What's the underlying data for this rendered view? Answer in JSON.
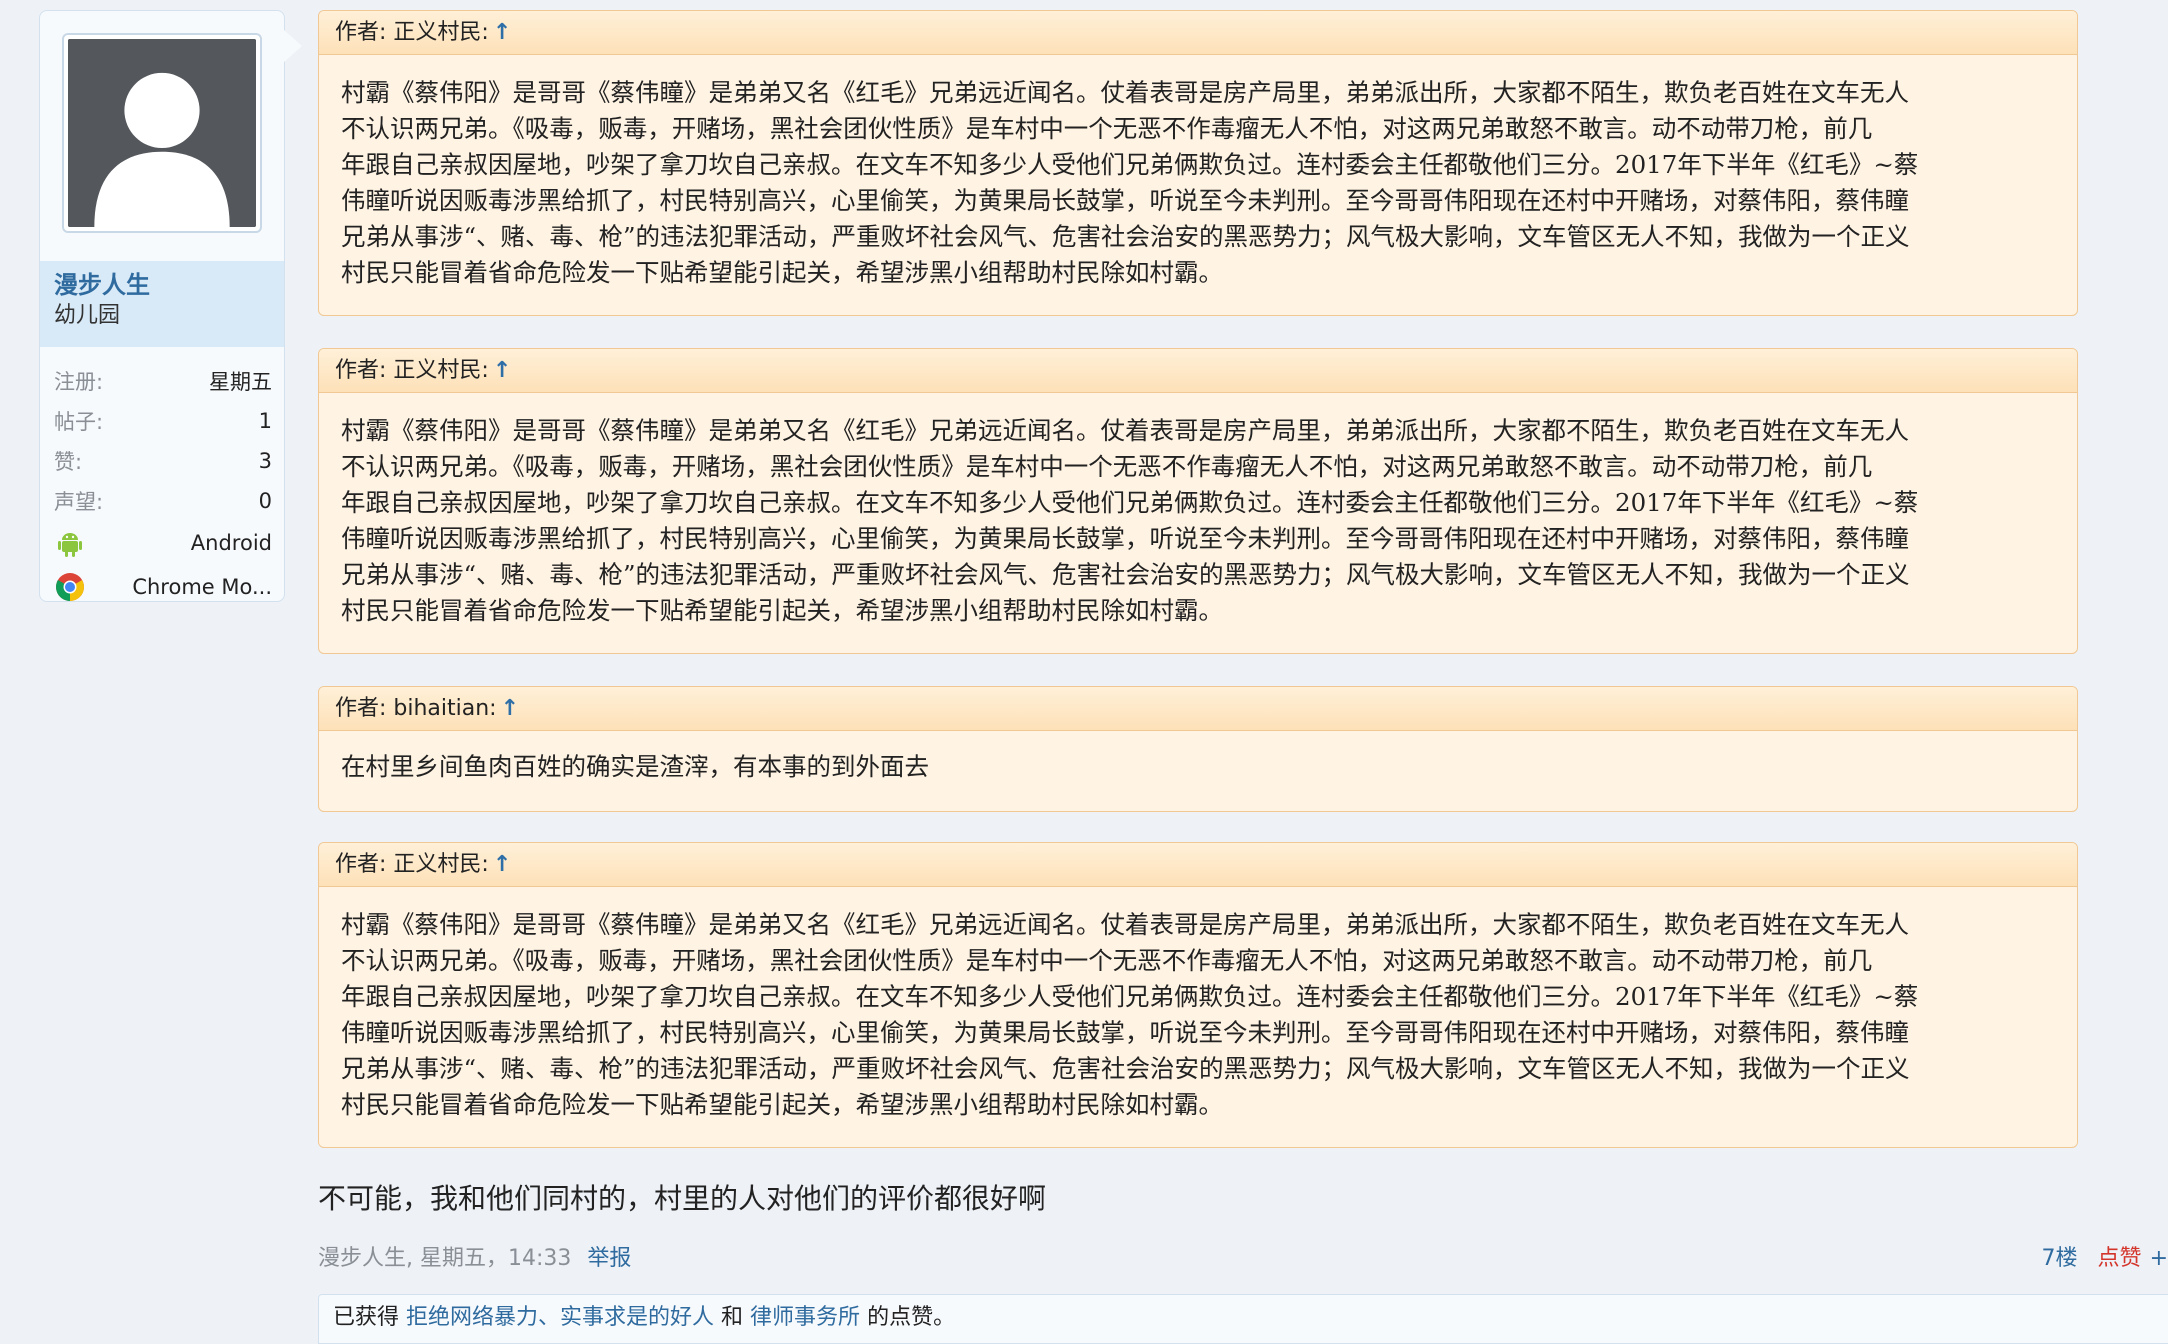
{
  "user": {
    "name": "漫步人生",
    "title": "幼儿园",
    "stats": [
      {
        "label": "注册:",
        "value": "星期五"
      },
      {
        "label": "帖子:",
        "value": "1"
      },
      {
        "label": "赞:",
        "value": "3"
      },
      {
        "label": "声望:",
        "value": "0"
      }
    ],
    "devices": [
      {
        "icon": "android-icon",
        "text": "Android"
      },
      {
        "icon": "chrome-icon",
        "text": "Chrome Mo..."
      }
    ]
  },
  "quotes": [
    {
      "author_label": "作者: 正义村民:",
      "arrow": "↑",
      "lines": [
        "村霸《蔡伟阳》是哥哥《蔡伟瞳》是弟弟又名《红毛》兄弟远近闻名。仗着表哥是房产局里，弟弟派出所，大家都不陌生，欺负老百姓在文车无人",
        "不认识两兄弟。《吸毒，贩毒，开赌场，黑社会团伙性质》是车村中一个无恶不作毒瘤无人不怕，对这两兄弟敢怒不敢言。动不动带刀枪，前几",
        "年跟自己亲叔因屋地，吵架了拿刀坎自己亲叔。在文车不知多少人受他们兄弟俩欺负过。连村委会主任都敬他们三分。2017年下半年《红毛》~蔡",
        "伟瞳听说因贩毒涉黑给抓了，村民特别高兴，心里偷笑，为黄果局长鼓掌，听说至今未判刑。至今哥哥伟阳现在还村中开赌场，对蔡伟阳，蔡伟瞳",
        "兄弟从事涉“、赌、毒、枪”的违法犯罪活动，严重败坏社会风气、危害社会治安的黑恶势力；风气极大影响，文车管区无人不知，我做为一个正义",
        "村民只能冒着省命危险发一下贴希望能引起关，希望涉黑小组帮助村民除如村霸。"
      ]
    },
    {
      "author_label": "作者: 正义村民:",
      "arrow": "↑",
      "lines": [
        "村霸《蔡伟阳》是哥哥《蔡伟瞳》是弟弟又名《红毛》兄弟远近闻名。仗着表哥是房产局里，弟弟派出所，大家都不陌生，欺负老百姓在文车无人",
        "不认识两兄弟。《吸毒，贩毒，开赌场，黑社会团伙性质》是车村中一个无恶不作毒瘤无人不怕，对这两兄弟敢怒不敢言。动不动带刀枪，前几",
        "年跟自己亲叔因屋地，吵架了拿刀坎自己亲叔。在文车不知多少人受他们兄弟俩欺负过。连村委会主任都敬他们三分。2017年下半年《红毛》~蔡",
        "伟瞳听说因贩毒涉黑给抓了，村民特别高兴，心里偷笑，为黄果局长鼓掌，听说至今未判刑。至今哥哥伟阳现在还村中开赌场，对蔡伟阳，蔡伟瞳",
        "兄弟从事涉“、赌、毒、枪”的违法犯罪活动，严重败坏社会风气、危害社会治安的黑恶势力；风气极大影响，文车管区无人不知，我做为一个正义",
        "村民只能冒着省命危险发一下贴希望能引起关，希望涉黑小组帮助村民除如村霸。"
      ]
    },
    {
      "author_label": "作者: bihaitian:",
      "arrow": "↑",
      "lines": [
        "在村里乡间鱼肉百姓的确实是渣滓，有本事的到外面去"
      ]
    },
    {
      "author_label": "作者: 正义村民:",
      "arrow": "↑",
      "lines": [
        "村霸《蔡伟阳》是哥哥《蔡伟瞳》是弟弟又名《红毛》兄弟远近闻名。仗着表哥是房产局里，弟弟派出所，大家都不陌生，欺负老百姓在文车无人",
        "不认识两兄弟。《吸毒，贩毒，开赌场，黑社会团伙性质》是车村中一个无恶不作毒瘤无人不怕，对这两兄弟敢怒不敢言。动不动带刀枪，前几",
        "年跟自己亲叔因屋地，吵架了拿刀坎自己亲叔。在文车不知多少人受他们兄弟俩欺负过。连村委会主任都敬他们三分。2017年下半年《红毛》~蔡",
        "伟瞳听说因贩毒涉黑给抓了，村民特别高兴，心里偷笑，为黄果局长鼓掌，听说至今未判刑。至今哥哥伟阳现在还村中开赌场，对蔡伟阳，蔡伟瞳",
        "兄弟从事涉“、赌、毒、枪”的违法犯罪活动，严重败坏社会风气、危害社会治安的黑恶势力；风气极大影响，文车管区无人不知，我做为一个正义",
        "村民只能冒着省命危险发一下贴希望能引起关，希望涉黑小组帮助村民除如村霸。"
      ]
    }
  ],
  "post": {
    "message": "不可能，我和他们同村的，村里的人对他们的评价都很好啊",
    "meta": "漫步人生, 星期五，14:33",
    "report": "举报",
    "floor": "7楼",
    "like": "点赞",
    "plus": "+"
  },
  "likes": {
    "prefix": "已获得",
    "user1": "拒绝网络暴力、实事求是的好人",
    "and": "和",
    "user2": "律师事务所",
    "suffix": "的点赞。"
  }
}
